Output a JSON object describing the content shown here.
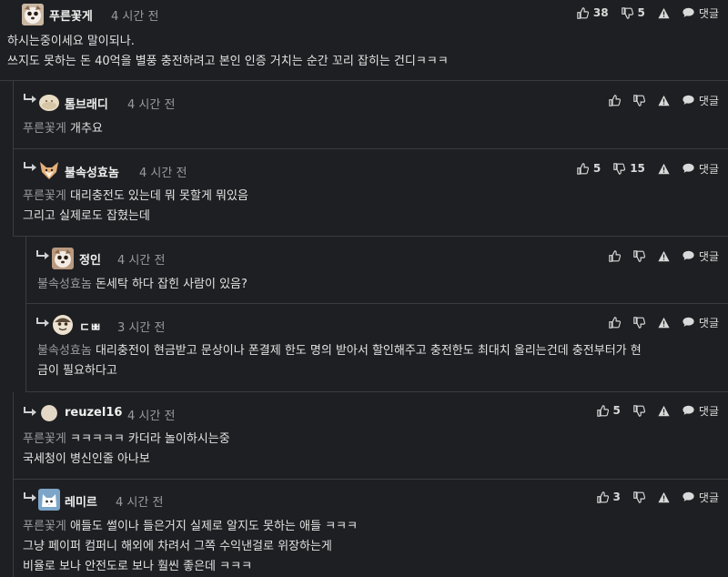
{
  "comments": [
    {
      "nickname": "푸른꽃게",
      "time": "4 시간 전",
      "likes": "38",
      "dislikes": "5",
      "reply_label": "댓글",
      "mention": "",
      "lines": [
        "하시는중이세요 말이되나.",
        "쓰지도 못하는 돈 40억을 별풍 충전하려고 본인 인증 거치는 순간 꼬리 잡히는 건디ㅋㅋㅋ"
      ],
      "avatar": "dog-face"
    },
    {
      "nickname": "톰브래디",
      "time": "4 시간 전",
      "likes": "",
      "dislikes": "",
      "reply_label": "댓글",
      "mention": "푸른꽃게",
      "lines": [
        "개추요"
      ],
      "avatar": "rice-ball"
    },
    {
      "nickname": "불속성효놈",
      "time": "4 시간 전",
      "likes": "5",
      "dislikes": "15",
      "reply_label": "댓글",
      "mention": "푸른꽃게",
      "lines": [
        "대리충전도 있는데 뭐 못할게 뭐있음",
        "그리고 실제로도 잡혔는데"
      ],
      "avatar": "fox"
    },
    {
      "nickname": "정인",
      "time": "4 시간 전",
      "likes": "",
      "dislikes": "",
      "reply_label": "댓글",
      "mention": "불속성효놈",
      "lines": [
        "돈세탁 하다 잡힌 사람이 있음?"
      ],
      "avatar": "dog-face"
    },
    {
      "nickname": "ㄷㅃ",
      "time": "3 시간 전",
      "likes": "",
      "dislikes": "",
      "reply_label": "댓글",
      "mention": "불속성효놈",
      "lines": [
        "대리충전이 현금받고 문상이나 폰결제 한도 명의 받아서 할인해주고 충전한도 최대치 올리는건데 충전부터가 현",
        "금이 필요하다고"
      ],
      "avatar": "face"
    },
    {
      "nickname": "reuzel16",
      "time": "4 시간 전",
      "likes": "5",
      "dislikes": "",
      "reply_label": "댓글",
      "mention": "푸른꽃게",
      "lines": [
        "ㅋㅋㅋㅋㅋ 카더라 놀이하시는중",
        "국세청이 병신인줄 아나보"
      ],
      "avatar": "plain"
    },
    {
      "nickname": "레미르",
      "time": "4 시간 전",
      "likes": "3",
      "dislikes": "",
      "reply_label": "댓글",
      "mention": "푸른꽃게",
      "lines": [
        "애들도 썰이나 들은거지 실제로 알지도 못하는 애들 ㅋㅋㅋ",
        "그냥 페이퍼 컴퍼니 해외에 차려서 그쪽 수익낸걸로 위장하는게",
        "비율로 보나 안전도로 보나 훨씬 좋은데 ㅋㅋㅋ"
      ],
      "avatar": "cat"
    }
  ]
}
